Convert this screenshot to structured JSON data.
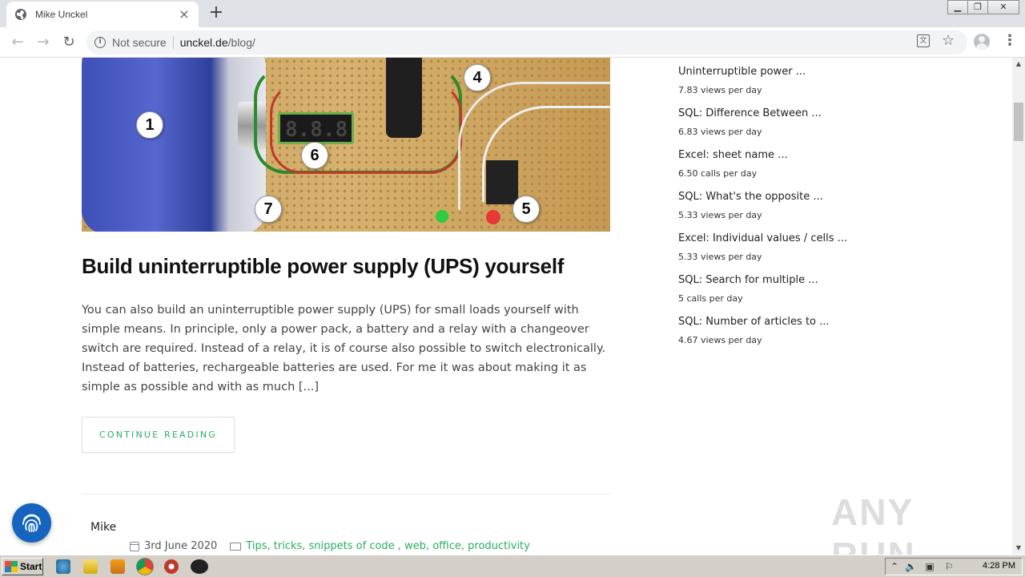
{
  "browser": {
    "tab_title": "Mike Unckel",
    "tab_close": "×",
    "new_tab": "+",
    "address": {
      "security_label": "Not secure",
      "host": "unckel.de",
      "path": "/blog/"
    }
  },
  "post": {
    "image_markers": [
      "1",
      "4",
      "6",
      "7",
      "5"
    ],
    "title": "Build uninterruptible power supply (UPS) yourself",
    "excerpt": "You can also build an uninterruptible power supply (UPS) for small loads yourself with simple means. In principle, only a power pack, a battery and a relay with a changeover switch are required. Instead of a relay, it is of course also possible to switch electronically. Instead of batteries, rechargeable batteries are used. For me it was about making it as simple as possible and with as much [...]",
    "continue_label": "CONTINUE READING"
  },
  "next_post": {
    "author": "Mike",
    "date": "3rd June 2020",
    "categories": "Tips, tricks, snippets of code , web, office, productivity"
  },
  "sidebar": {
    "popular": [
      {
        "title": "Uninterruptible power ...",
        "views": "7.83 views per day"
      },
      {
        "title": "SQL: Difference Between ...",
        "views": "6.83 views per day"
      },
      {
        "title": "Excel: sheet name ...",
        "views": "6.50 calls per day"
      },
      {
        "title": "SQL: What's the opposite ...",
        "views": "5.33 views per day"
      },
      {
        "title": "Excel: Individual values / cells ...",
        "views": "5.33 views per day"
      },
      {
        "title": "SQL: Search for multiple ...",
        "views": "5 calls per day"
      },
      {
        "title": "SQL: Number of articles to ...",
        "views": "4.67 views per day"
      }
    ]
  },
  "watermark": "ANY RUN",
  "taskbar": {
    "start_label": "Start",
    "clock": "4:28 PM"
  },
  "colors": {
    "accent_green": "#27ae60",
    "fingerprint_blue": "#1565c0"
  }
}
